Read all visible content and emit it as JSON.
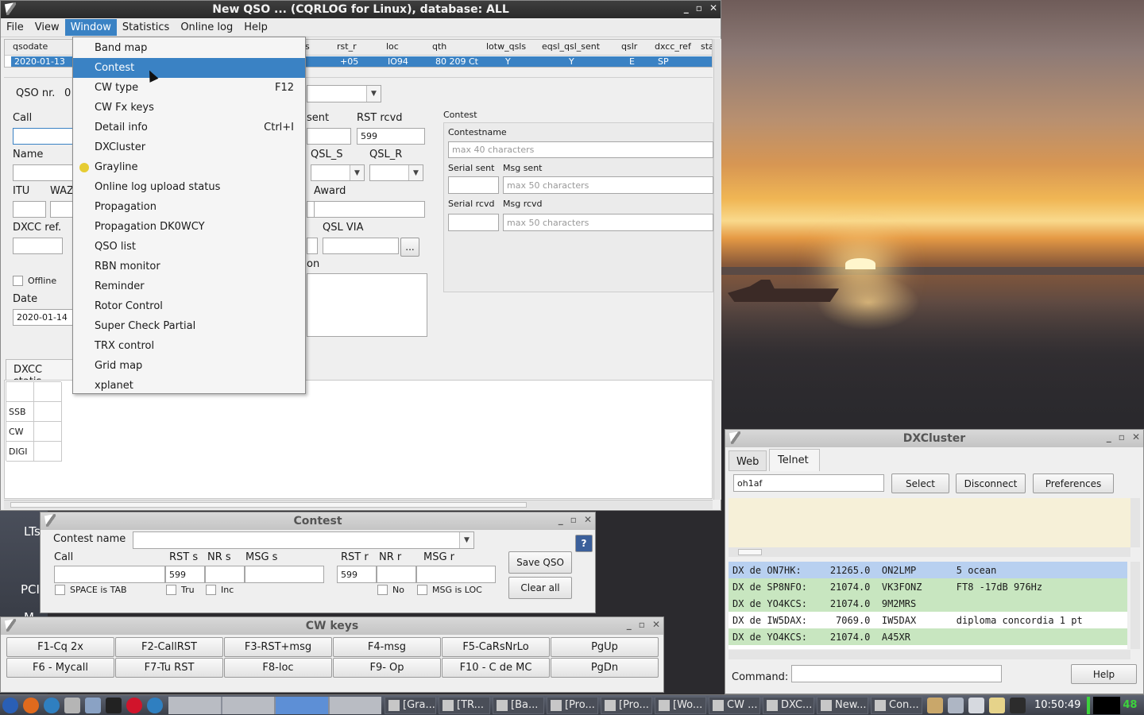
{
  "main_window": {
    "title": "New QSO ... (CQRLOG for Linux), database: ALL",
    "menus": [
      "File",
      "View",
      "Window",
      "Statistics",
      "Online log",
      "Help"
    ],
    "grid_headers": [
      "qsodate",
      "s",
      "rst_r",
      "loc",
      "qth",
      "lotw_qsls",
      "eqsl_qsl_sent",
      "qslr",
      "dxcc_ref",
      "sta"
    ],
    "grid_row": [
      "2020-01-13",
      "+05",
      "IO94",
      "80 209 Ct",
      "Y",
      "Y",
      "E",
      "SP"
    ],
    "qso_nr_label": "QSO nr.",
    "qso_nr_value": "0",
    "call_label": "Call",
    "name_label": "Name",
    "itu_label": "ITU",
    "waz_label": "WAZ",
    "dxcc_ref_label": "DXCC ref.",
    "offline_label": "Offline",
    "date_label": "Date",
    "date_value": "2020-01-14",
    "sent_label": "sent",
    "rst_rcvd_label": "RST rcvd",
    "rst_rcvd_value": "599",
    "qsl_s_label": "QSL_S",
    "qsl_r_label": "QSL_R",
    "award_label": "Award",
    "qsl_via_label": "QSL VIA",
    "more_button": "...",
    "comment_label_partial": "on",
    "dxcc_tab": "DXCC statis",
    "stats_rows": [
      "SSB",
      "CW",
      "DIGI"
    ],
    "contest_group_label": "Contest",
    "contestname_label": "Contestname",
    "contestname_placeholder": "max 40 characters",
    "serial_sent_label": "Serial sent",
    "msg_sent_label": "Msg sent",
    "msg_sent_placeholder": "max 50 characters",
    "serial_rcvd_label": "Serial rcvd",
    "msg_rcvd_label": "Msg rcvd",
    "msg_rcvd_placeholder": "max 50 characters"
  },
  "window_menu": {
    "items": [
      {
        "label": "Band map",
        "shortcut": ""
      },
      {
        "label": "Contest",
        "shortcut": ""
      },
      {
        "label": "CW type",
        "shortcut": "F12"
      },
      {
        "label": "CW Fx keys",
        "shortcut": ""
      },
      {
        "label": "Detail info",
        "shortcut": "Ctrl+I"
      },
      {
        "label": "DXCluster",
        "shortcut": ""
      },
      {
        "label": "Grayline",
        "shortcut": ""
      },
      {
        "label": "Online log upload status",
        "shortcut": ""
      },
      {
        "label": "Propagation",
        "shortcut": ""
      },
      {
        "label": "Propagation DK0WCY",
        "shortcut": ""
      },
      {
        "label": "QSO list",
        "shortcut": ""
      },
      {
        "label": "RBN monitor",
        "shortcut": ""
      },
      {
        "label": "Reminder",
        "shortcut": ""
      },
      {
        "label": "Rotor Control",
        "shortcut": ""
      },
      {
        "label": "Super Check Partial",
        "shortcut": ""
      },
      {
        "label": "TRX control",
        "shortcut": ""
      },
      {
        "label": "Grid map",
        "shortcut": ""
      },
      {
        "label": "xplanet",
        "shortcut": ""
      }
    ]
  },
  "contest_window": {
    "title": "Contest",
    "contest_name_label": "Contest name",
    "call_label": "Call",
    "rst_s_label": "RST s",
    "nr_s_label": "NR s",
    "msg_s_label": "MSG s",
    "rst_r_label": "RST r",
    "nr_r_label": "NR r",
    "msg_r_label": "MSG r",
    "rst_s_value": "599",
    "rst_r_value": "599",
    "space_tab_label": "SPACE is TAB",
    "tru_label": "Tru",
    "inc_label": "Inc",
    "no_label": "No",
    "msg_loc_label": "MSG is LOC",
    "save_button": "Save QSO",
    "clear_button": "Clear all",
    "help_icon": "?"
  },
  "cw_window": {
    "title": "CW keys",
    "keys": [
      "F1-Cq 2x",
      "F2-CallRST",
      "F3-RST+msg",
      "F4-msg",
      "F5-CaRsNrLo",
      "PgUp",
      "F6 - Mycall",
      "F7-Tu RST",
      "F8-loc",
      "F9- Op",
      "F10 - C de MC",
      "PgDn"
    ]
  },
  "dxcluster": {
    "title": "DXCluster",
    "tabs": [
      "Web",
      "Telnet"
    ],
    "callsign_value": "oh1af",
    "select_button": "Select",
    "disconnect_button": "Disconnect",
    "preferences_button": "Preferences",
    "spots": [
      "DX de ON7HK:     21265.0  ON2LMP       5 ocean",
      "DX de SP8NFO:    21074.0  VK3FONZ      FT8 -17dB 976Hz",
      "DX de YO4KCS:    21074.0  9M2MRS",
      "DX de IW5DAX:     7069.0  IW5DAX       diploma concordia 1 pt",
      "DX de YO4KCS:    21074.0  A45XR"
    ],
    "command_label": "Command:",
    "help_button": "Help"
  },
  "desktop": {
    "left_labels": [
      "LTs",
      "PCI",
      "M"
    ]
  },
  "taskbar": {
    "tasks": [
      "[Gra...",
      "[TR...",
      "[Ba...",
      "[Pro...",
      "[Pro...",
      "[Wo...",
      "CW ...",
      "DXC...",
      "New...",
      "Con..."
    ],
    "clock": "10:50:49",
    "battery": "48"
  },
  "colors": {
    "menu_highlight": "#3a82c4",
    "spot_highlight": "#b8d0f0",
    "spot_green": "#c8e6c0",
    "cluster_bg": "#f6f0d8"
  }
}
